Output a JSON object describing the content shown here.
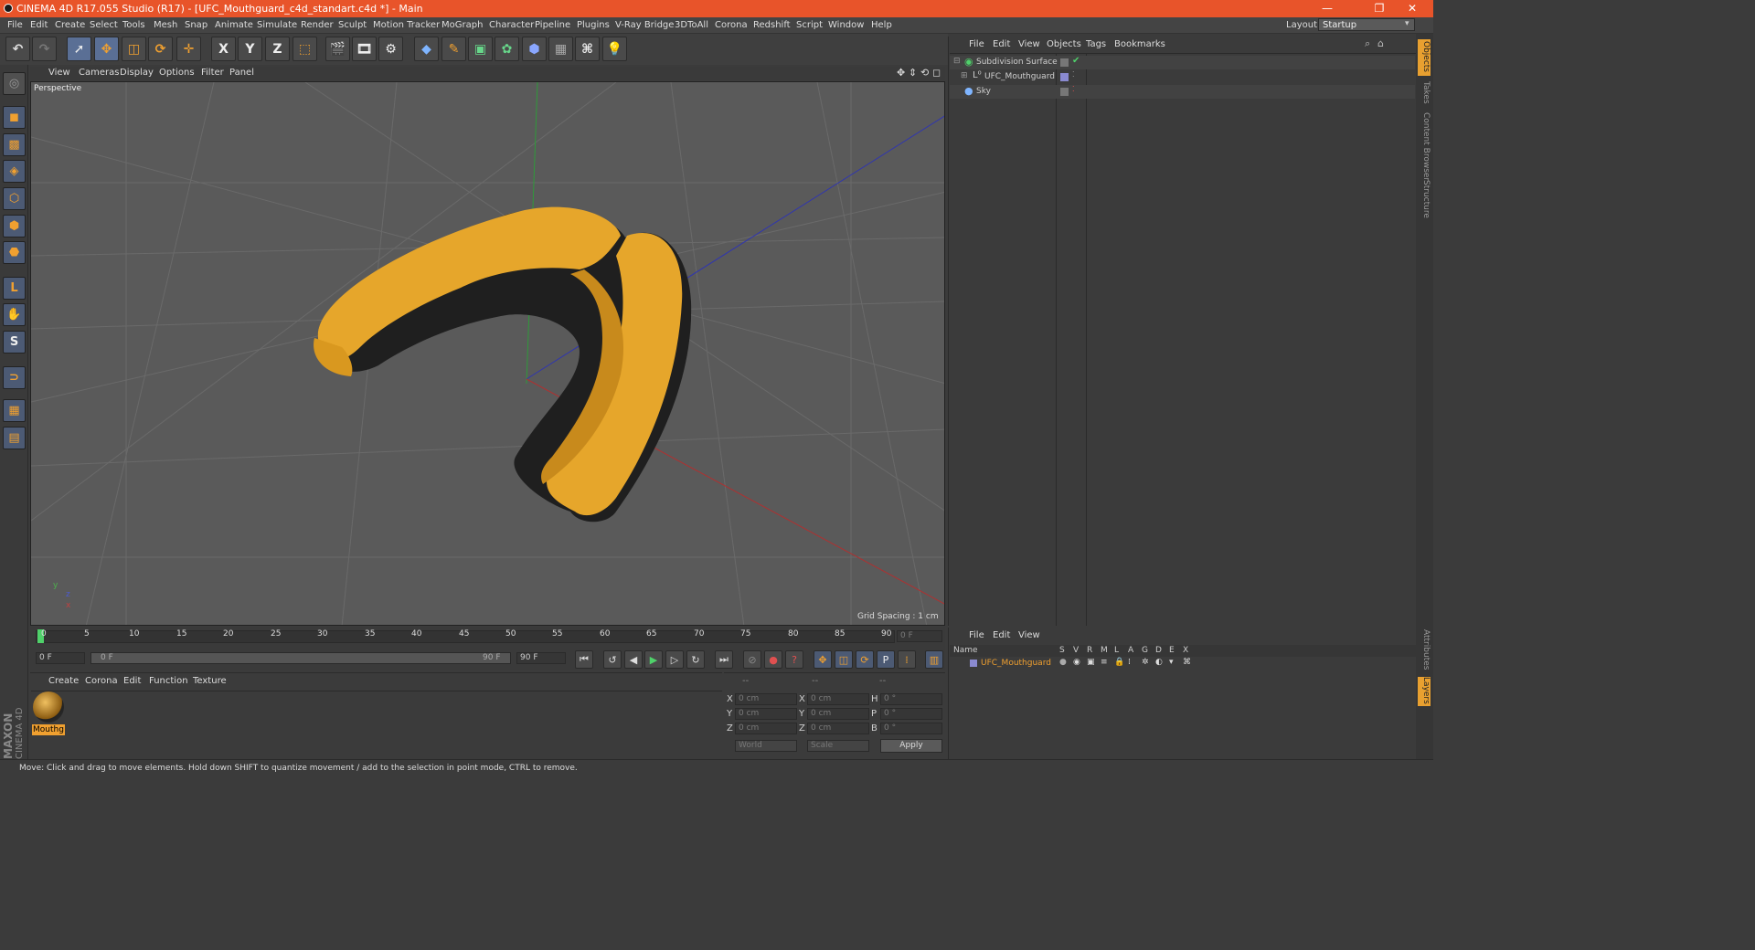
{
  "app": {
    "title": "CINEMA 4D R17.055 Studio (R17) - [UFC_Mouthguard_c4d_standart.c4d *] - Main",
    "window_controls": [
      "—",
      "❐",
      "✕"
    ]
  },
  "menu": [
    "File",
    "Edit",
    "Create",
    "Select",
    "Tools",
    "Mesh",
    "Snap",
    "Animate",
    "Simulate",
    "Render",
    "Sculpt",
    "Motion Tracker",
    "MoGraph",
    "Character",
    "Pipeline",
    "Plugins",
    "V-Ray Bridge",
    "3DToAll",
    "Corona",
    "Redshift",
    "Script",
    "Window",
    "Help"
  ],
  "layout": {
    "label": "Layout:",
    "value": "Startup"
  },
  "toolbar": {
    "axis_x": "X",
    "axis_y": "Y",
    "axis_z": "Z"
  },
  "viewport": {
    "menu": [
      "View",
      "Cameras",
      "Display",
      "Options",
      "Filter",
      "Panel"
    ],
    "label": "Perspective",
    "grid_spacing": "Grid Spacing : 1 cm",
    "axis_x": "x",
    "axis_y": "y",
    "axis_z": "z"
  },
  "timeline": {
    "ticks": [
      "0",
      "5",
      "10",
      "15",
      "20",
      "25",
      "30",
      "35",
      "40",
      "45",
      "50",
      "55",
      "60",
      "65",
      "70",
      "75",
      "80",
      "85",
      "90"
    ],
    "current_frame": "0 F",
    "start": "0 F",
    "slider_start": "0 F",
    "slider_end": "90 F",
    "end": "90 F"
  },
  "materials": {
    "menu": [
      "Create",
      "Corona",
      "Edit",
      "Function",
      "Texture"
    ],
    "items": [
      {
        "name": "Mouthg"
      }
    ]
  },
  "coords": {
    "headers": [
      "--",
      "--",
      "--"
    ],
    "rows": [
      {
        "l1": "X",
        "v1": "0 cm",
        "l2": "X",
        "v2": "0 cm",
        "l3": "H",
        "v3": "0 °"
      },
      {
        "l1": "Y",
        "v1": "0 cm",
        "l2": "Y",
        "v2": "0 cm",
        "l3": "P",
        "v3": "0 °"
      },
      {
        "l1": "Z",
        "v1": "0 cm",
        "l2": "Z",
        "v2": "0 cm",
        "l3": "B",
        "v3": "0 °"
      }
    ],
    "mode1": "World",
    "mode2": "Scale",
    "apply": "Apply"
  },
  "objects": {
    "menu": [
      "File",
      "Edit",
      "View",
      "Objects",
      "Tags",
      "Bookmarks"
    ],
    "tree": [
      {
        "name": "Subdivision Surface",
        "color": "#8fd1a0"
      },
      {
        "name": "UFC_Mouthguard",
        "color": "#cfcfcf"
      },
      {
        "name": "Sky",
        "color": "#cfcfcf"
      }
    ]
  },
  "layers": {
    "menu": [
      "File",
      "Edit",
      "View"
    ],
    "columns": [
      "Name",
      "S",
      "V",
      "R",
      "M",
      "L",
      "A",
      "G",
      "D",
      "E",
      "X"
    ],
    "rows": [
      {
        "name": "UFC_Mouthguard",
        "color": "#f0a030"
      }
    ]
  },
  "right_tabs": [
    "Objects",
    "Takes",
    "Content Browser",
    "Structure",
    "Attributes",
    "Layers"
  ],
  "maxon": {
    "brand": "MAXON",
    "product": "CINEMA 4D"
  },
  "status": "Move: Click and drag to move elements. Hold down SHIFT to quantize movement / add to the selection in point mode, CTRL to remove.",
  "colors": {
    "title_bar": "#e8542a",
    "accent": "#f0a030",
    "object_yellow": "#e6a62b"
  }
}
